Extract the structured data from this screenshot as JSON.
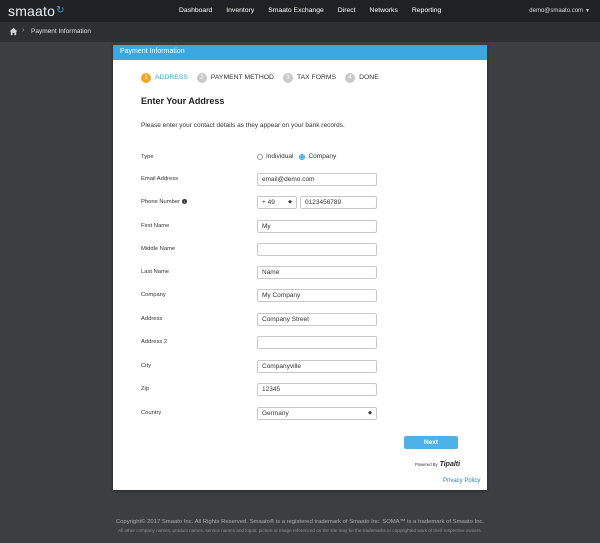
{
  "app": {
    "logo_text": "smaato",
    "brand_color": "#3aa7e0"
  },
  "nav": {
    "items": [
      "Dashboard",
      "Inventory",
      "Smaato Exchange",
      "Direct",
      "Networks",
      "Reporting"
    ],
    "user": "demo@smaato.com"
  },
  "breadcrumb": {
    "home_icon": "home-icon",
    "label": "Payment Information"
  },
  "card": {
    "header": "Payment Information"
  },
  "steps": [
    {
      "num": "1",
      "label": "ADDRESS",
      "active": true
    },
    {
      "num": "2",
      "label": "PAYMENT METHOD",
      "active": false
    },
    {
      "num": "3",
      "label": "TAX FORMS",
      "active": false
    },
    {
      "num": "4",
      "label": "DONE",
      "active": false
    }
  ],
  "form": {
    "title": "Enter Your Address",
    "description": "Please enter your contact details as they appear on your bank records.",
    "type": {
      "label": "Type",
      "options": [
        "Individual",
        "Company"
      ],
      "selected": "Company"
    },
    "email": {
      "label": "Email Address",
      "value": "email@demo.com"
    },
    "phone": {
      "label": "Phone Number",
      "code": "+ 49",
      "value": "0123456789"
    },
    "first_name": {
      "label": "First Name",
      "value": "My"
    },
    "middle_name": {
      "label": "Middle Name",
      "value": ""
    },
    "last_name": {
      "label": "Last Name",
      "value": "Name"
    },
    "company": {
      "label": "Company",
      "value": "My Company"
    },
    "address": {
      "label": "Address",
      "value": "Company Street"
    },
    "address2": {
      "label": "Address 2",
      "value": ""
    },
    "city": {
      "label": "City",
      "value": "Companyville"
    },
    "zip": {
      "label": "Zip",
      "value": "12345"
    },
    "country": {
      "label": "Country",
      "value": "Germany"
    },
    "next": "Next",
    "powered_by": "Powered By",
    "powered_brand": "Tipalti",
    "privacy": "Privacy Policy"
  },
  "footer": {
    "line1": "Copyright© 2017 Smaato Inc. All Rights Reserved. Smaato® is a registered trademark of Smaato Inc. SOMA™ is a trademark of Smaato Inc.",
    "line2": "All other company names, product names, service names and logos, picture or image referenced on the site may be the trademarks or copyrighted work of their respective owners."
  }
}
